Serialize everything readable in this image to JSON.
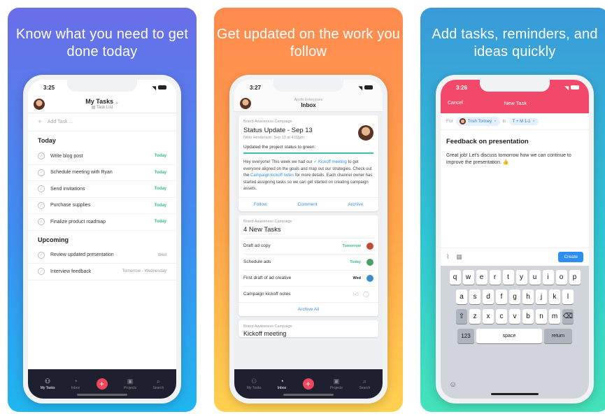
{
  "panel1": {
    "heading": "Know what you need to get done today",
    "time": "3:25",
    "title": "My Tasks",
    "subtitle": "Task List",
    "add_placeholder": "Add Task ...",
    "section_today": "Today",
    "today_tasks": [
      {
        "name": "Write blog post",
        "due": "Today"
      },
      {
        "name": "Schedule meeting with Ryan",
        "due": "Today"
      },
      {
        "name": "Send invitations",
        "due": "Today"
      },
      {
        "name": "Purchase supplies",
        "due": "Today"
      },
      {
        "name": "Finalize product roadmap",
        "due": "Today"
      }
    ],
    "section_upcoming": "Upcoming",
    "upcoming_tasks": [
      {
        "name": "Review updated presentation",
        "due": "Wed"
      },
      {
        "name": "Interview feedback",
        "due": "Tomorrow - Wednesday"
      }
    ],
    "tabs": {
      "my_tasks": "My Tasks",
      "inbox": "Inbox",
      "projects": "Projects",
      "search": "Search"
    }
  },
  "panel2": {
    "heading": "Get updated on the work you follow",
    "time": "3:27",
    "org": "Apollo Enterprises",
    "title": "Inbox",
    "card1": {
      "project": "Brand Awareness Campaign",
      "title": "Status Update - Sep 13",
      "meta": "Nikki Henderson, Sep 13 at 4:02pm",
      "status": "Updated the project status to green:",
      "body_1": "Hey everyone! This week we had our ",
      "link_1": "✓ Kickoff meeting",
      "body_2": " to get everyone aligned on the goals and map out our strategies. Check out the ",
      "link_2": "Campaign kickoff notes",
      "body_3": " for more details. Each channel owner has started assigning tasks so we can get started on creating campaign assets.",
      "actions": {
        "follow": "Follow",
        "comment": "Comment",
        "archive": "Archive"
      }
    },
    "card2": {
      "project": "Brand Awareness Campaign",
      "title": "4 New Tasks",
      "rows": [
        {
          "name": "Draft ad copy",
          "due": "Tomorrow"
        },
        {
          "name": "Schedule ads",
          "due": "Today"
        },
        {
          "name": "First draft of ad creative",
          "due": "Wed"
        },
        {
          "name": "Campaign kickoff notes",
          "due": ""
        }
      ],
      "archive_all": "Archive All"
    },
    "card3": {
      "project": "Brand Awareness Campaign",
      "title": "Kickoff meeting"
    },
    "tabs": {
      "my_tasks": "My Tasks",
      "inbox": "Inbox",
      "projects": "Projects",
      "search": "Search"
    }
  },
  "panel3": {
    "heading": "Add tasks, reminders, and ideas quickly",
    "time": "3:26",
    "cancel": "Cancel",
    "title": "New Task",
    "for_label": "For",
    "assignee": "Trish Tormey",
    "in_label": "in",
    "project": "T + M 1-1",
    "task_title": "Feedback on presentation",
    "task_desc": "Great job! Let's discuss tomorrow how we can continue to improve the presentation. 👍",
    "create": "Create",
    "kb_row1": [
      "q",
      "w",
      "e",
      "r",
      "t",
      "y",
      "u",
      "i",
      "o",
      "p"
    ],
    "kb_row2": [
      "a",
      "s",
      "d",
      "f",
      "g",
      "h",
      "j",
      "k",
      "l"
    ],
    "kb_row3": [
      "z",
      "x",
      "c",
      "v",
      "b",
      "n",
      "m"
    ],
    "kb_123": "123",
    "kb_space": "space",
    "kb_return": "return"
  },
  "colors": {
    "asana_red": "#f0455d",
    "link_blue": "#2f8fe0",
    "today_green": "#3ab795"
  }
}
